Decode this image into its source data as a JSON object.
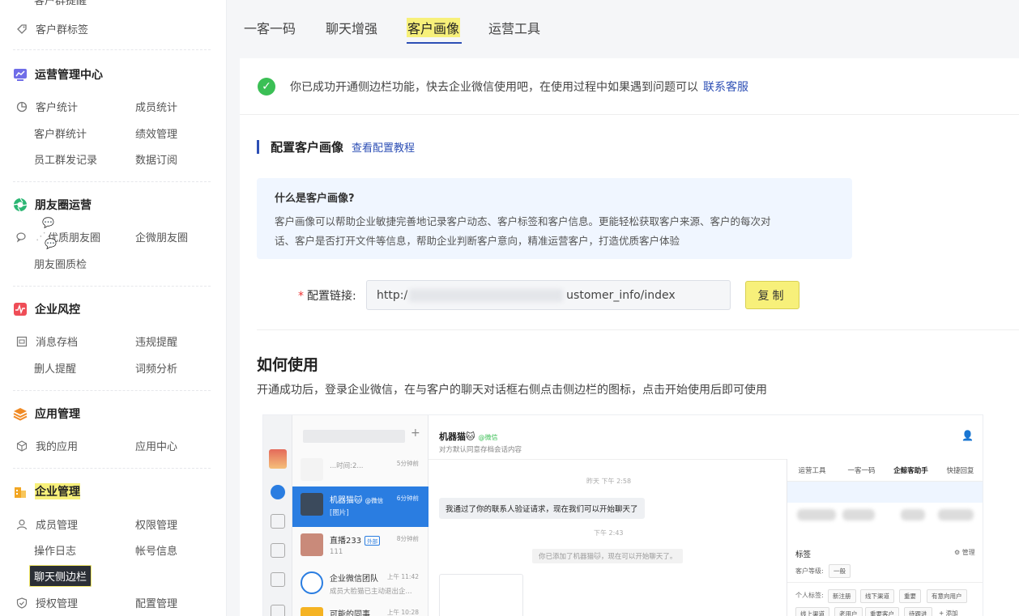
{
  "sidebar": {
    "cut_top_item": "客户群提醒",
    "tag_item": "客户群标签",
    "sections": [
      {
        "title": "运营管理中心",
        "items": [
          "客户统计",
          "成员统计",
          "客户群统计",
          "绩效管理",
          "员工群发记录",
          "数据订阅"
        ]
      },
      {
        "title": "朋友圈运营",
        "items": [
          "优质朋友圈",
          "企微朋友圈",
          "朋友圈质检"
        ]
      },
      {
        "title": "企业风控",
        "items": [
          "消息存档",
          "违规提醒",
          "删人提醒",
          "词频分析"
        ]
      },
      {
        "title": "应用管理",
        "items": [
          "我的应用",
          "应用中心"
        ]
      },
      {
        "title": "企业管理",
        "items": [
          "成员管理",
          "权限管理",
          "操作日志",
          "帐号信息",
          "授权管理",
          "配置管理"
        ]
      }
    ],
    "tooltip": "聊天侧边栏"
  },
  "tabs": [
    "一客一码",
    "聊天增强",
    "客户画像",
    "运营工具"
  ],
  "active_tab": "客户画像",
  "notice": {
    "text": "你已成功开通侧边栏功能，快去企业微信使用吧，在使用过程中如果遇到问题可以",
    "link": "联系客服"
  },
  "config": {
    "title": "配置客户画像",
    "tutorial_link": "查看配置教程",
    "what_title": "什么是客户画像?",
    "what_desc_1": "客户画像可以帮助企业敏捷完善地记录客户动态、客户标签和客户信息。更能轻松获取客户来源、客户的每次对",
    "what_desc_2": "话、客户是否打开文件等信息，帮助企业判断客户意向，精准运营客户，打造优质客户体验",
    "link_label": "配置链接:",
    "link_prefix": "http:/",
    "link_suffix": "ustomer_info/index",
    "copy_button": "复制"
  },
  "howto": {
    "title": "如何使用",
    "desc": "开通成功后，登录企业微信，在与客户的聊天对话框右侧点击侧边栏的图标，点击开始使用后即可使用"
  },
  "preview": {
    "convs": [
      {
        "name": "",
        "msg": "...时间:2...",
        "time": "5分钟前"
      },
      {
        "name": "机器猫🐱",
        "src": "@微信",
        "msg": "[图片]",
        "time": "6分钟前"
      },
      {
        "name": "直播233",
        "badge": "外部",
        "msg": "111",
        "time": "8分钟前"
      },
      {
        "name": "企业微信团队",
        "msg": "成员大脸猫已主动退出企...",
        "time": "上午 11:42"
      },
      {
        "name": "可能的同事",
        "msg": "",
        "time": "上午 10:28"
      }
    ],
    "chat_name": "机器猫🐱",
    "chat_src": "@微信",
    "chat_sub": "对方默认同意存档会话内容",
    "stamp_1": "昨天 下午 2:58",
    "bubble_1": "我通过了你的联系人验证请求，现在我们可以开始聊天了",
    "stamp_2": "下午 2:43",
    "sys_msg": "你已添加了机器猫🐱，现在可以开始聊天了。",
    "side_tabs": [
      "运营工具",
      "一客一码",
      "企鲸客助手",
      "快捷回复"
    ],
    "side_tag_title": "标签",
    "side_manage": "⚙ 管理",
    "side_level_label": "客户等级:",
    "side_level_value": "一般",
    "side_personal_label": "个人标签:",
    "side_tags": [
      "新注册",
      "线下渠道",
      "重要",
      "有意向用户",
      "线上渠道",
      "老用户",
      "重要客户",
      "待跟进",
      "+ 添加"
    ]
  }
}
